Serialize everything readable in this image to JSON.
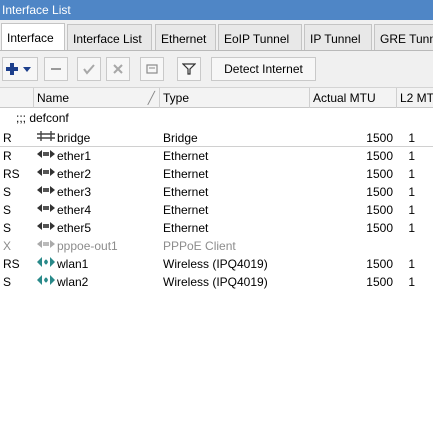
{
  "window": {
    "title": "Interface List"
  },
  "tabs": [
    {
      "label": "Interface"
    },
    {
      "label": "Interface List"
    },
    {
      "label": "Ethernet"
    },
    {
      "label": "EoIP Tunnel"
    },
    {
      "label": "IP Tunnel"
    },
    {
      "label": "GRE Tunn"
    }
  ],
  "toolbar": {
    "detect_label": "Detect Internet"
  },
  "table": {
    "columns": [
      "Name",
      "Type",
      "Actual MTU",
      "L2 MT"
    ],
    "group_label": ";;; defconf",
    "rows": [
      {
        "flag": "R",
        "name": "bridge",
        "type": "Bridge",
        "mtu": "1500",
        "l2": "1",
        "icon": "bridge-icon"
      },
      {
        "flag": "R",
        "name": "ether1",
        "type": "Ethernet",
        "mtu": "1500",
        "l2": "1",
        "icon": "ethernet-icon"
      },
      {
        "flag": "RS",
        "name": "ether2",
        "type": "Ethernet",
        "mtu": "1500",
        "l2": "1",
        "icon": "ethernet-icon"
      },
      {
        "flag": "S",
        "name": "ether3",
        "type": "Ethernet",
        "mtu": "1500",
        "l2": "1",
        "icon": "ethernet-icon"
      },
      {
        "flag": "S",
        "name": "ether4",
        "type": "Ethernet",
        "mtu": "1500",
        "l2": "1",
        "icon": "ethernet-icon"
      },
      {
        "flag": "S",
        "name": "ether5",
        "type": "Ethernet",
        "mtu": "1500",
        "l2": "1",
        "icon": "ethernet-icon"
      },
      {
        "flag": "X",
        "name": "pppoe-out1",
        "type": "PPPoE Client",
        "mtu": "",
        "l2": "",
        "icon": "pppoe-icon",
        "disabled": true
      },
      {
        "flag": "RS",
        "name": "wlan1",
        "type": "Wireless (IPQ4019)",
        "mtu": "1500",
        "l2": "1",
        "icon": "wireless-icon"
      },
      {
        "flag": "S",
        "name": "wlan2",
        "type": "Wireless (IPQ4019)",
        "mtu": "1500",
        "l2": "1",
        "icon": "wireless-icon"
      }
    ]
  },
  "colors": {
    "titlebar": "#4f86c6",
    "add": "#1d3f8c",
    "wireless": "#2a8a8a"
  }
}
